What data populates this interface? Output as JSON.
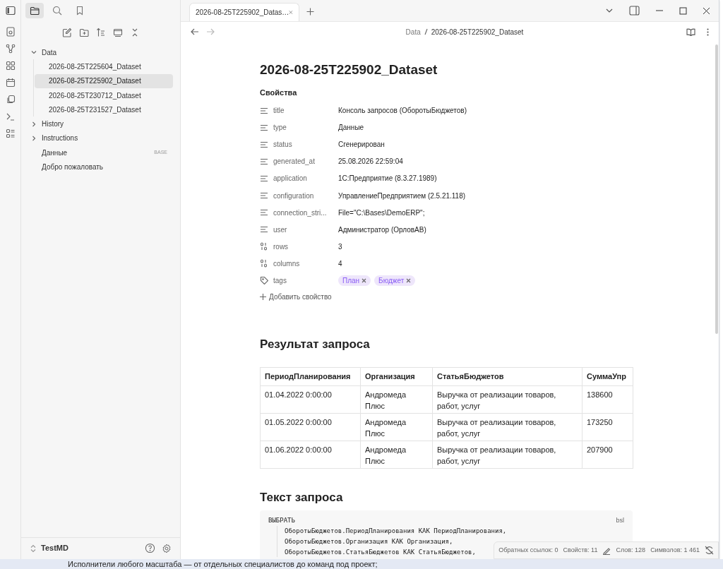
{
  "sidebar_tabs": [
    {
      "kind": "files",
      "selected": true
    },
    {
      "kind": "search",
      "selected": false
    },
    {
      "kind": "bookmarks",
      "selected": false
    }
  ],
  "file_tree": [
    {
      "kind": "folder",
      "label": "Data",
      "expanded": true,
      "children": [
        {
          "kind": "file",
          "label": "2026-08-25T225604_Dataset",
          "selected": false
        },
        {
          "kind": "file",
          "label": "2026-08-25T225902_Dataset",
          "selected": true
        },
        {
          "kind": "file",
          "label": "2026-08-25T230712_Dataset",
          "selected": false
        },
        {
          "kind": "file",
          "label": "2026-08-25T231527_Dataset",
          "selected": false
        }
      ]
    },
    {
      "kind": "folder",
      "label": "History",
      "expanded": false
    },
    {
      "kind": "folder",
      "label": "Instructions",
      "expanded": false
    },
    {
      "kind": "file",
      "label": "Данные",
      "badge": "BASE",
      "selected": false
    },
    {
      "kind": "file",
      "label": "Добро пожаловать",
      "selected": false
    }
  ],
  "vault": "TestMD",
  "tabs": [
    {
      "label": "2026-08-25T225902_Datas…",
      "selected": true
    }
  ],
  "breadcrumb": [
    "Data",
    "2026-08-25T225902_Dataset"
  ],
  "note": {
    "title": "2026-08-25T225902_Dataset",
    "properties_heading": "Свойства",
    "properties": [
      {
        "kind": "text",
        "name": "title",
        "value": "Консоль запросов (ОборотыБюджетов)"
      },
      {
        "kind": "text",
        "name": "type",
        "value": "Данные"
      },
      {
        "kind": "text",
        "name": "status",
        "value": "Сгенерирован"
      },
      {
        "kind": "text",
        "name": "generated_at",
        "value": "25.08.2026 22:59:04"
      },
      {
        "kind": "text",
        "name": "application",
        "value": "1С:Предприятие (8.3.27.1989)"
      },
      {
        "kind": "text",
        "name": "configuration",
        "value": "УправлениеПредприятием (2.5.21.118)"
      },
      {
        "kind": "text",
        "name": "connection_stri...",
        "value": "File=\"C:\\Bases\\DemoERP\";"
      },
      {
        "kind": "text",
        "name": "user",
        "value": "Администратор (ОрловАВ)"
      },
      {
        "kind": "number",
        "name": "rows",
        "value": "3"
      },
      {
        "kind": "number",
        "name": "columns",
        "value": "4"
      },
      {
        "kind": "tags",
        "name": "tags",
        "tags": [
          "План",
          "Бюджет"
        ]
      }
    ],
    "add_property": "Добавить свойство",
    "result_heading": "Результат запроса",
    "table": {
      "columns": [
        "ПериодПланирования",
        "Организация",
        "СтатьяБюджетов",
        "СуммаУпр"
      ],
      "rows": [
        [
          "01.04.2022 0:00:00",
          "Андромеда Плюс",
          "Выручка от реализации товаров, работ, услуг",
          "138600"
        ],
        [
          "01.05.2022 0:00:00",
          "Андромеда Плюс",
          "Выручка от реализации товаров, работ, услуг",
          "173250"
        ],
        [
          "01.06.2022 0:00:00",
          "Андромеда Плюс",
          "Выручка от реализации товаров, работ, услуг",
          "207900"
        ]
      ]
    },
    "query_heading": "Текст запроса",
    "code": {
      "language": "bsl",
      "lines": [
        {
          "text": "ВЫБРАТЬ",
          "children": [
            {
              "text": "ОборотыБюджетов.ПериодПланирования КАК ПериодПланирования,"
            },
            {
              "text": "ОборотыБюджетов.Организация КАК Организация,"
            },
            {
              "text": "ОборотыБюджетов.СтатьяБюджетов КАК СтатьяБюджетов,"
            }
          ]
        }
      ]
    }
  },
  "status_bar": {
    "backlinks": "Обратных ссылок: 0",
    "properties": "Свойств: 11",
    "words": "Слов: 128",
    "characters": "Символов: 1 461"
  },
  "background_text": "Исполнители любого масштаба — от отдельных специалистов до команд под проект;"
}
